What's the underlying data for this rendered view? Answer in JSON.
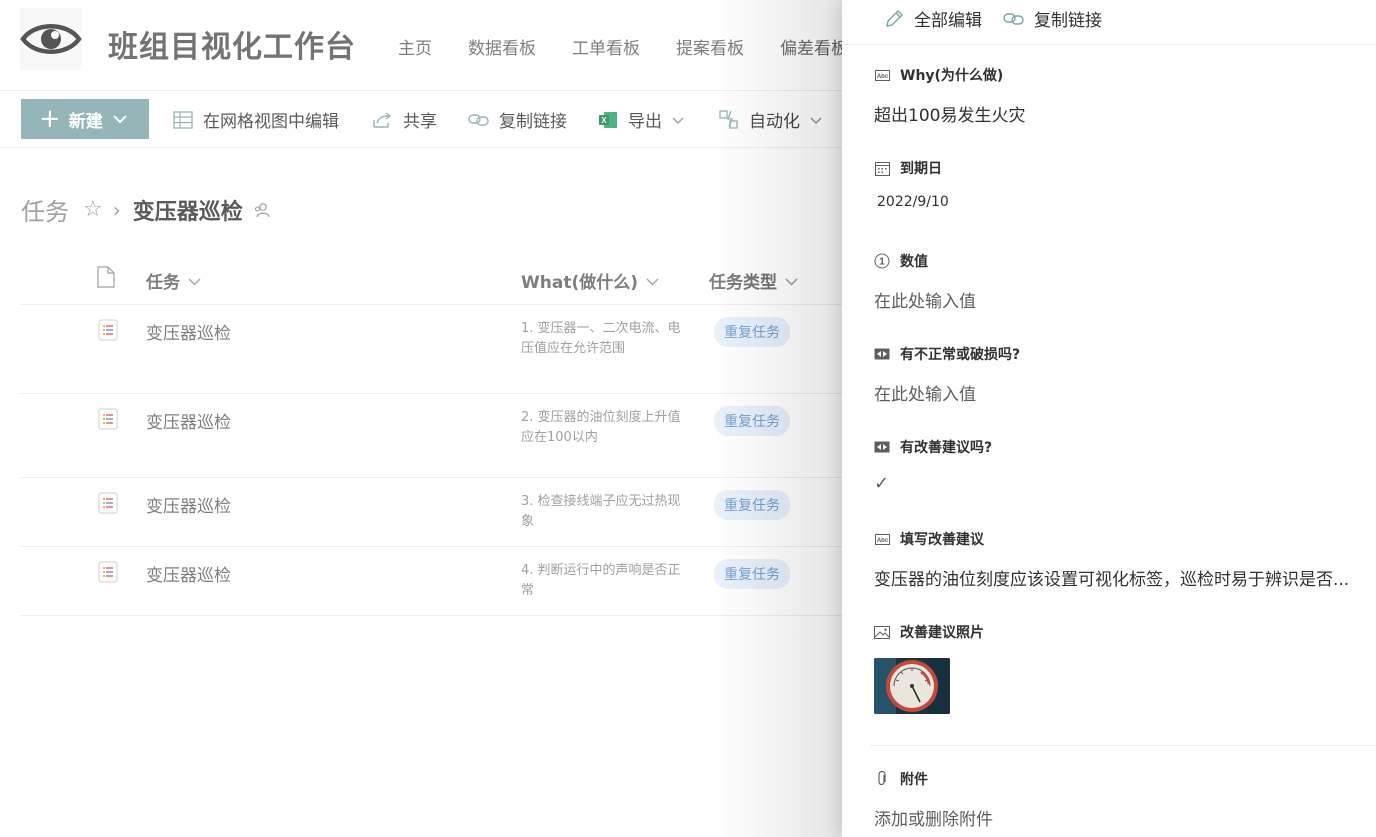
{
  "header": {
    "site_title": "班组目视化工作台",
    "nav": [
      "主页",
      "数据看板",
      "工单看板",
      "提案看板",
      "偏差看板"
    ]
  },
  "commandbar": {
    "new_label": "新建",
    "grid_edit": "在网格视图中编辑",
    "share": "共享",
    "copy_link": "复制链接",
    "export": "导出",
    "automate": "自动化"
  },
  "breadcrumb": {
    "root": "任务",
    "current": "变压器巡检"
  },
  "table": {
    "columns": [
      "任务",
      "What(做什么)",
      "任务类型"
    ],
    "rows": [
      {
        "title": "变压器巡检",
        "what": "1. 变压器一、二次电流、电压值应在允许范围",
        "type": "重复任务"
      },
      {
        "title": "变压器巡检",
        "what": "2. 变压器的油位刻度上升值应在100以内",
        "type": "重复任务"
      },
      {
        "title": "变压器巡检",
        "what": "3. 检查接线端子应无过热现象",
        "type": "重复任务"
      },
      {
        "title": "变压器巡检",
        "what": "4. 判断运行中的声响是否正常",
        "type": "重复任务"
      }
    ]
  },
  "panel": {
    "edit_all": "全部编辑",
    "copy_link": "复制链接",
    "fields": {
      "why": {
        "label": "Why(为什么做)",
        "value": "超出100易发生火灾"
      },
      "due": {
        "label": "到期日",
        "value": "2022/9/10"
      },
      "number": {
        "label": "数值",
        "value": "在此处输入值"
      },
      "abnormal": {
        "label": "有不正常或破损吗?",
        "value": "在此处输入值"
      },
      "suggest_q": {
        "label": "有改善建议吗?",
        "value": "✓"
      },
      "suggest": {
        "label": "填写改善建议",
        "value": "变压器的油位刻度应该设置可视化标签，巡检时易于辨识是否..."
      },
      "photo": {
        "label": "改善建议照片"
      },
      "attach": {
        "label": "附件",
        "value": "添加或删除附件"
      }
    }
  },
  "colors": {
    "accent": "#7aa4a6",
    "tag_bg": "#e3eefa",
    "tag_text": "#5c8fc4"
  }
}
